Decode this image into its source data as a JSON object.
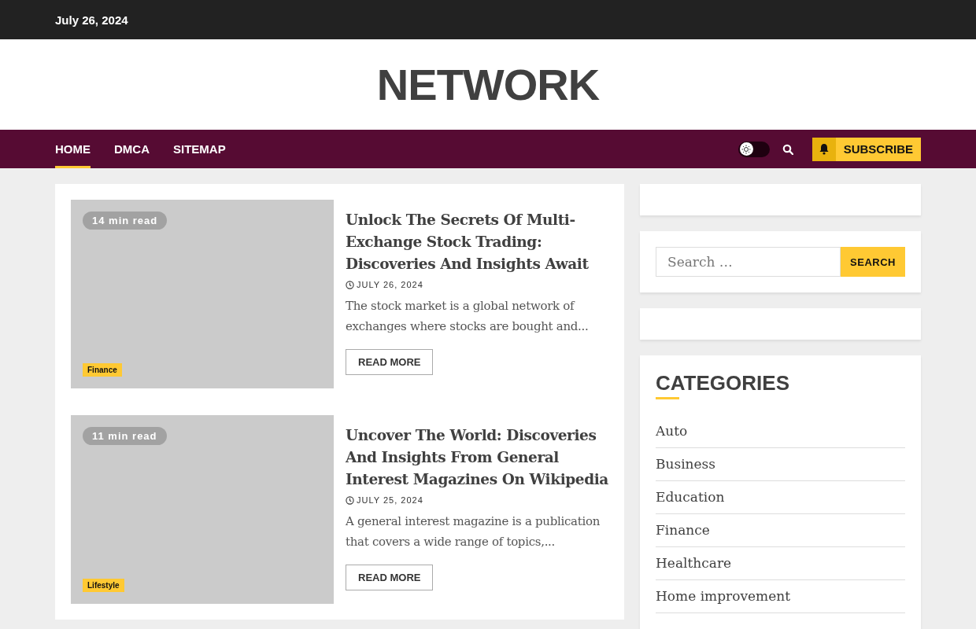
{
  "top_bar": {
    "date": "July 26, 2024"
  },
  "site_title": "NETWORK",
  "nav": {
    "items": [
      {
        "label": "HOME",
        "selected": true
      },
      {
        "label": "DMCA",
        "selected": false
      },
      {
        "label": "SITEMAP",
        "selected": false
      }
    ],
    "dark_mode": {
      "on": false
    },
    "subscribe": "SUBSCRIBE"
  },
  "articles": [
    {
      "read_time": "14 min read",
      "category": "Finance",
      "title": "Unlock The Secrets Of Multi-Exchange Stock Trading: Discoveries And Insights Await",
      "date": "JULY 26, 2024",
      "excerpt": "The stock market is a global network of exchanges where stocks are bought and...",
      "button": "READ MORE"
    },
    {
      "read_time": "11 min read",
      "category": "Lifestyle",
      "title": "Uncover The World: Discoveries And Insights From General Interest Magazines On Wikipedia",
      "date": "JULY 25, 2024",
      "excerpt": "A general interest magazine is a publication that covers a wide range of topics,...",
      "button": "READ MORE"
    }
  ],
  "search": {
    "placeholder": "Search …",
    "button": "SEARCH"
  },
  "categories": {
    "title": "CATEGORIES",
    "items": [
      "Auto",
      "Business",
      "Education",
      "Finance",
      "Healthcare",
      "Home improvement"
    ]
  }
}
